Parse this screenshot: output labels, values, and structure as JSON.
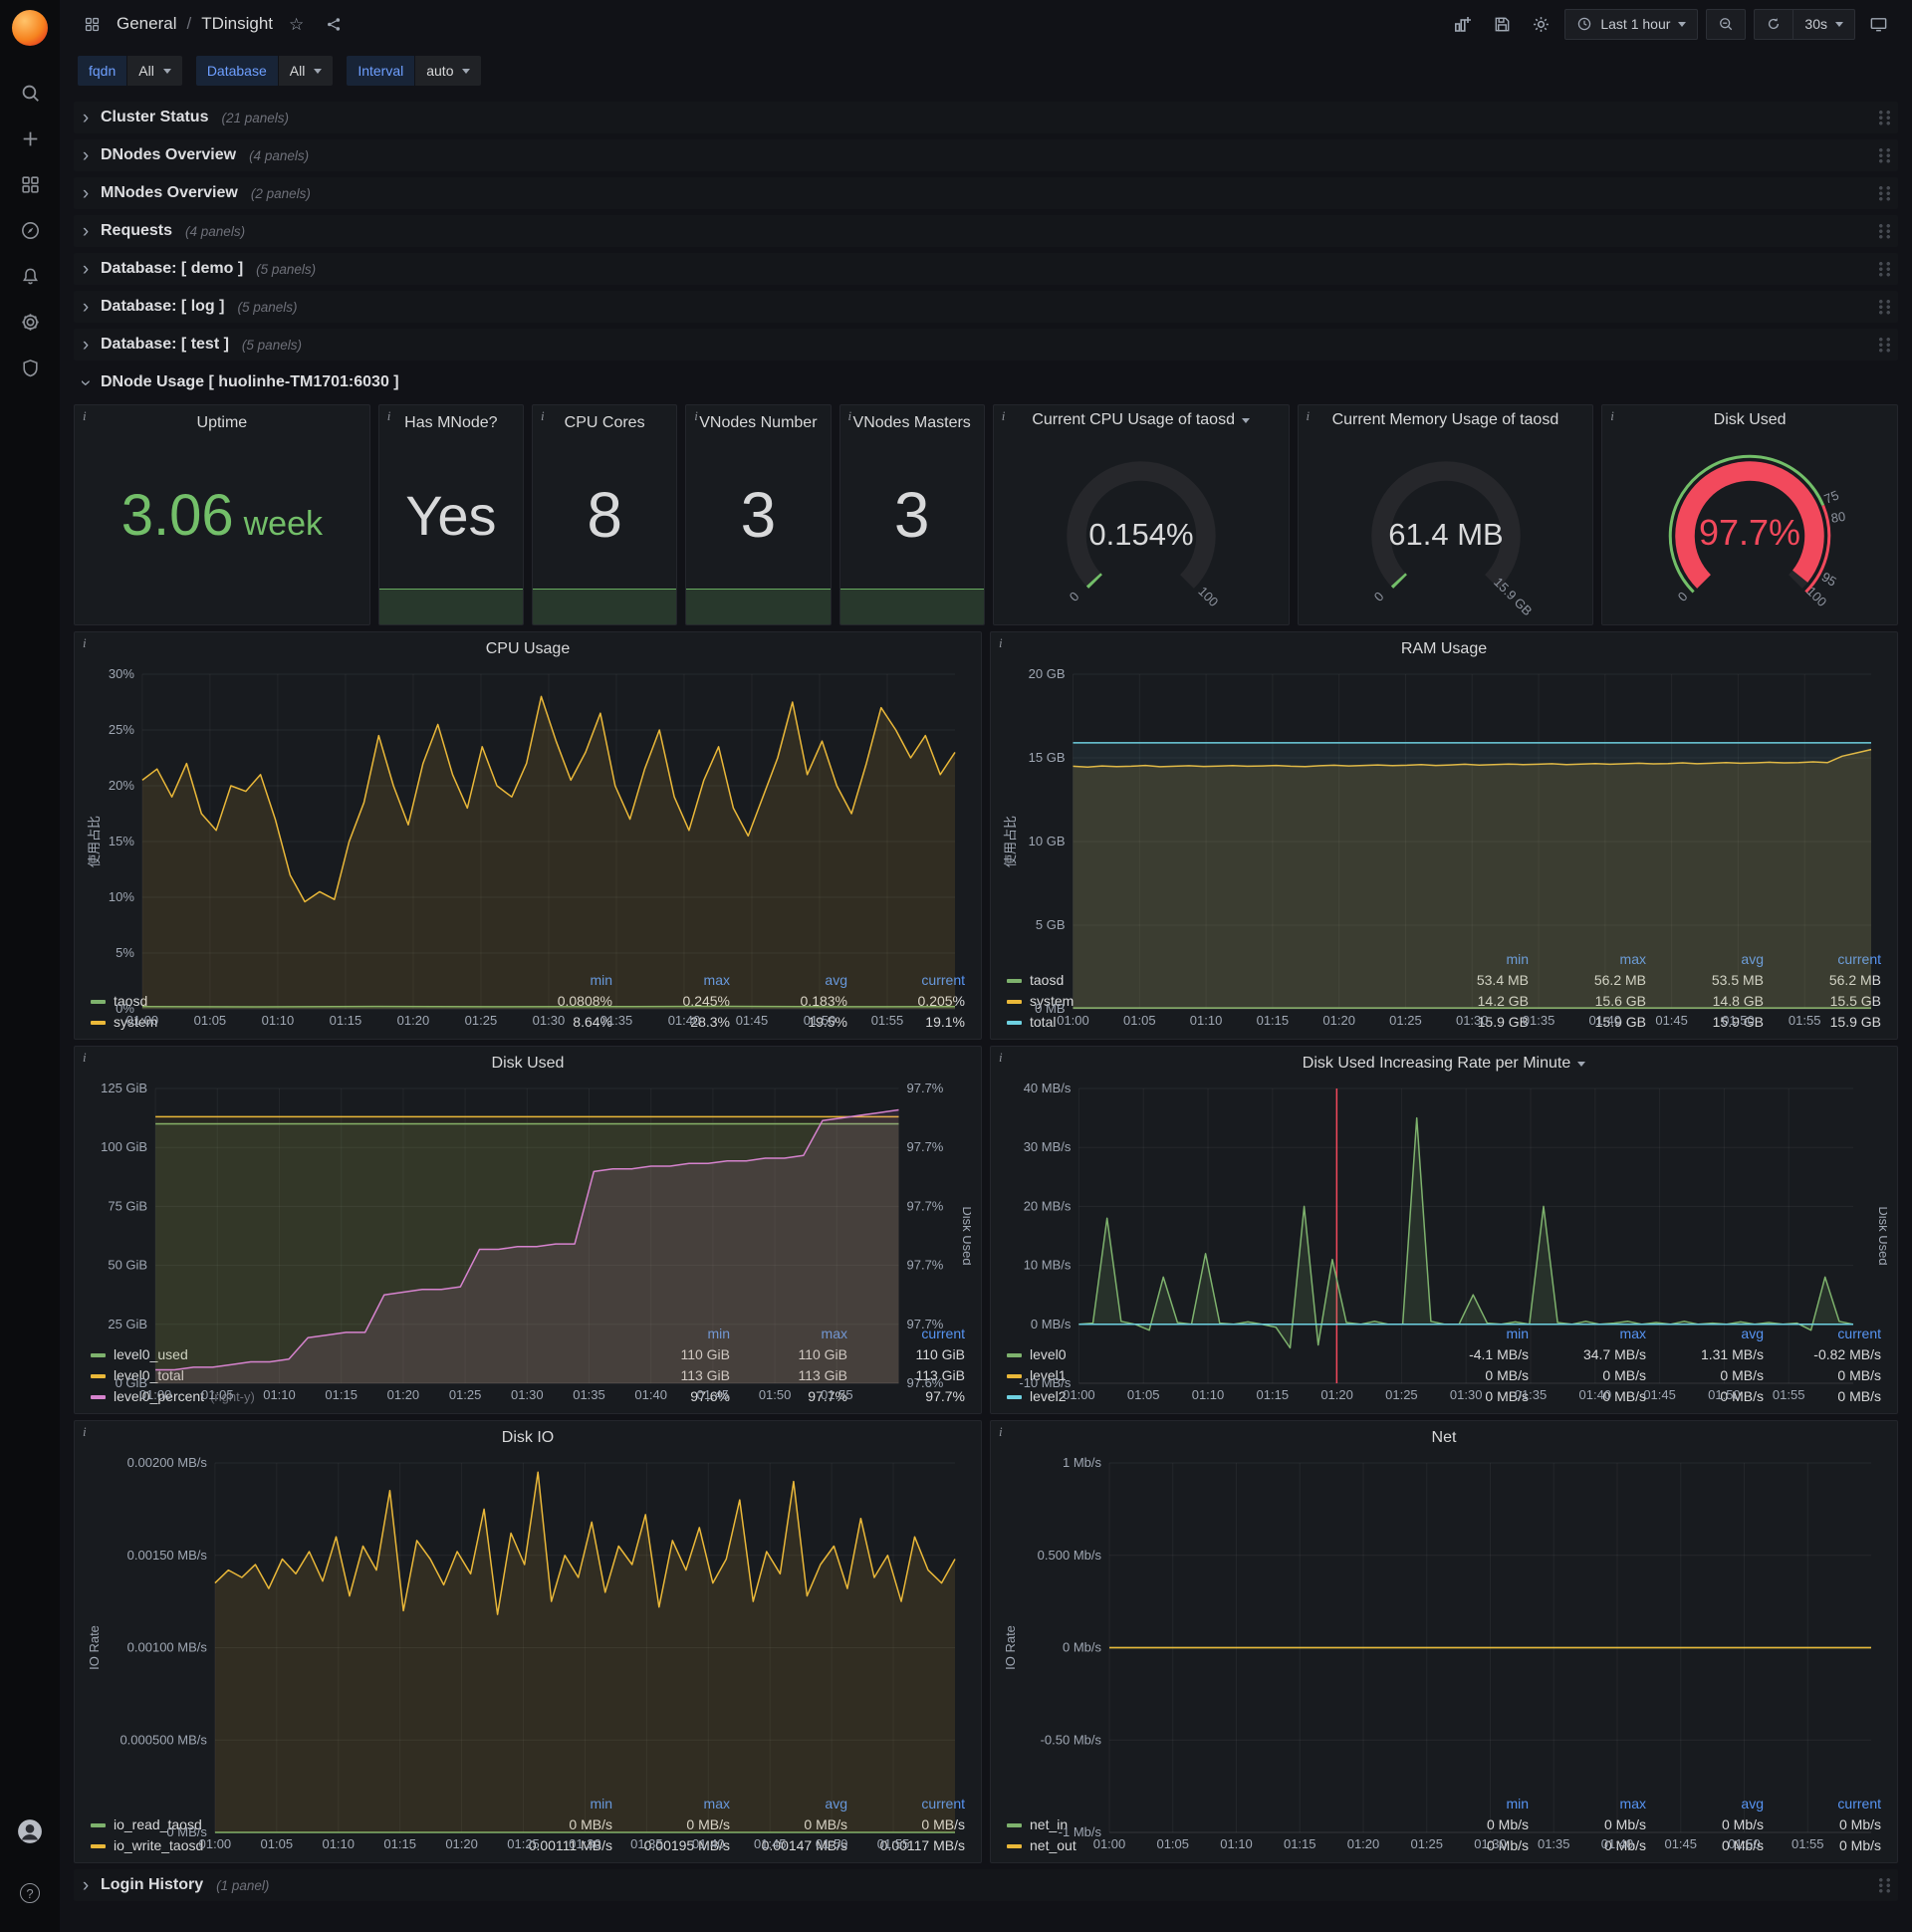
{
  "icons": {
    "info": "i",
    "star": "☆",
    "chevron": "›",
    "help": "?"
  },
  "colors": {
    "green": "#73BF69",
    "yellow": "#EAB839",
    "blue": "#6ED0E0",
    "pink": "#D683CE",
    "red": "#F2495C",
    "accent_blue": "#5794F2"
  },
  "topnav": {
    "section": "General",
    "separator": "/",
    "title": "TDinsight",
    "time_range": "Last 1 hour",
    "refresh": "30s"
  },
  "variables": [
    {
      "label": "fqdn",
      "value": "All"
    },
    {
      "label": "Database",
      "value": "All"
    },
    {
      "label": "Interval",
      "value": "auto"
    }
  ],
  "rows": [
    {
      "title": "Cluster Status",
      "count": "(21 panels)"
    },
    {
      "title": "DNodes Overview",
      "count": "(4 panels)"
    },
    {
      "title": "MNodes Overview",
      "count": "(2 panels)"
    },
    {
      "title": "Requests",
      "count": "(4 panels)"
    },
    {
      "title": "Database: [ demo ]",
      "count": "(5 panels)"
    },
    {
      "title": "Database: [ log ]",
      "count": "(5 panels)"
    },
    {
      "title": "Database: [ test ]",
      "count": "(5 panels)"
    }
  ],
  "expanded_row": {
    "title": "DNode Usage [ huolinhe-TM1701:6030 ]"
  },
  "bottom_row": {
    "title": "Login History",
    "count": "(1 panel)"
  },
  "stats": {
    "uptime": {
      "title": "Uptime",
      "value": "3.06",
      "unit": "week"
    },
    "has_mnode": {
      "title": "Has MNode?",
      "value": "Yes"
    },
    "cpu_cores": {
      "title": "CPU Cores",
      "value": "8"
    },
    "vnodes_number": {
      "title": "VNodes Number",
      "value": "3"
    },
    "vnodes_masters": {
      "title": "VNodes Masters",
      "value": "3"
    }
  },
  "gauges": [
    {
      "title": "Current CPU Usage of taosd",
      "value": "0.154%",
      "fraction": 0.00154,
      "value_color": "#d8d9da",
      "arc_color": "#73BF69",
      "value_size": 31,
      "labels": [
        {
          "text": "0",
          "frac": 0
        },
        {
          "text": "100",
          "frac": 1
        }
      ]
    },
    {
      "title": "Current Memory Usage of taosd",
      "value": "61.4 MB",
      "fraction": 0.004,
      "value_color": "#d8d9da",
      "arc_color": "#73BF69",
      "value_size": 31,
      "labels": [
        {
          "text": "0",
          "frac": 0
        },
        {
          "text": "15.9 GB",
          "frac": 1
        }
      ]
    },
    {
      "title": "Disk Used",
      "value": "97.7%",
      "fraction": 0.977,
      "value_color": "#F2495C",
      "arc_color": "#F2495C",
      "value_size": 36,
      "threshold_ring": [
        {
          "from": 0,
          "to": 0.75,
          "color": "#73BF69"
        },
        {
          "from": 0.75,
          "to": 1,
          "color": "#F2495C"
        }
      ],
      "labels": [
        {
          "text": "0",
          "frac": 0
        },
        {
          "text": "75",
          "frac": 0.75
        },
        {
          "text": "80",
          "frac": 0.8
        },
        {
          "text": "95",
          "frac": 0.95
        },
        {
          "text": "100",
          "frac": 1
        }
      ]
    }
  ],
  "chart_data": [
    {
      "id": "cpu_usage",
      "type": "line",
      "title": "CPU Usage",
      "ylabel": "使用占比",
      "y_min": 0,
      "y_max": 30,
      "left_ticks": [
        "0%",
        "5%",
        "10%",
        "15%",
        "20%",
        "25%",
        "30%"
      ],
      "x_ticks": [
        "01:00",
        "01:05",
        "01:10",
        "01:15",
        "01:20",
        "01:25",
        "01:30",
        "01:35",
        "01:40",
        "01:45",
        "01:50",
        "01:55"
      ],
      "series": [
        {
          "name": "taosd",
          "color": "#7EB26D",
          "fill": 0.12,
          "values": [
            0.2,
            0.18,
            0.21,
            0.19,
            0.2,
            0.22,
            0.19,
            0.2
          ]
        },
        {
          "name": "system",
          "color": "#EAB839",
          "fill": 0.12,
          "values": [
            20.5,
            21.5,
            19,
            22,
            17.5,
            16,
            20,
            19.5,
            21,
            17,
            12,
            9.6,
            10.5,
            9.8,
            15,
            18.5,
            24.5,
            20,
            16.5,
            22,
            25.5,
            21,
            18,
            23.5,
            20,
            19,
            22,
            28,
            24,
            20.5,
            23,
            26.5,
            20,
            17,
            21.5,
            25,
            19,
            16,
            20.5,
            23.5,
            18,
            15.5,
            19,
            22.5,
            27.5,
            21,
            24,
            20,
            17.5,
            22,
            27,
            25,
            22.5,
            24.5,
            21,
            23
          ]
        }
      ],
      "legend": {
        "columns": [
          "min",
          "max",
          "avg",
          "current"
        ],
        "rows": [
          {
            "name": "taosd",
            "color": "#7EB26D",
            "values": [
              "0.0808%",
              "0.245%",
              "0.183%",
              "0.205%"
            ]
          },
          {
            "name": "system",
            "color": "#EAB839",
            "values": [
              "8.64%",
              "28.3%",
              "19.5%",
              "19.1%"
            ]
          }
        ]
      }
    },
    {
      "id": "ram_usage",
      "type": "line",
      "title": "RAM Usage",
      "ylabel": "使用占比",
      "y_min": 0,
      "y_max": 20,
      "left_ticks": [
        "0 MB",
        "5 GB",
        "10 GB",
        "15 GB",
        "20 GB"
      ],
      "x_ticks": [
        "01:00",
        "01:05",
        "01:10",
        "01:15",
        "01:20",
        "01:25",
        "01:30",
        "01:35",
        "01:40",
        "01:45",
        "01:50",
        "01:55"
      ],
      "series": [
        {
          "name": "taosd",
          "color": "#7EB26D",
          "fill": 0.15,
          "values": [
            0.053,
            0.053
          ]
        },
        {
          "name": "system",
          "color": "#EAB839",
          "fill": 0.15,
          "values": [
            14.5,
            14.45,
            14.52,
            14.48,
            14.5,
            14.55,
            14.47,
            14.5,
            14.53,
            14.49,
            14.51,
            14.54,
            14.5,
            14.52,
            14.55,
            14.5,
            14.48,
            14.53,
            14.56,
            14.52,
            14.55,
            14.58,
            14.54,
            14.56,
            14.6,
            14.55,
            14.58,
            14.62,
            14.57,
            14.6,
            14.63,
            14.6,
            14.62,
            14.65,
            14.6,
            14.63,
            14.66,
            14.62,
            14.65,
            14.68,
            14.64,
            14.66,
            14.7,
            14.65,
            14.68,
            14.72,
            14.68,
            14.7,
            14.74,
            14.7,
            14.72,
            14.76,
            14.72,
            15.1,
            15.3,
            15.5
          ]
        },
        {
          "name": "total",
          "color": "#6ED0E0",
          "fill": 0.08,
          "values": [
            15.9,
            15.9
          ]
        }
      ],
      "legend": {
        "columns": [
          "min",
          "max",
          "avg",
          "current"
        ],
        "rows": [
          {
            "name": "taosd",
            "color": "#7EB26D",
            "values": [
              "53.4 MB",
              "56.2 MB",
              "53.5 MB",
              "56.2 MB"
            ]
          },
          {
            "name": "system",
            "color": "#EAB839",
            "values": [
              "14.2 GB",
              "15.6 GB",
              "14.8 GB",
              "15.5 GB"
            ]
          },
          {
            "name": "total",
            "color": "#6ED0E0",
            "values": [
              "15.9 GB",
              "15.9 GB",
              "15.9 GB",
              "15.9 GB"
            ]
          }
        ]
      }
    },
    {
      "id": "disk_used",
      "type": "line",
      "title": "Disk Used",
      "y_min": 0,
      "y_max": 125,
      "right_min": 97.595,
      "right_max": 97.705,
      "right_label": "Disk Used",
      "left_ticks": [
        "0 GiB",
        "25 GiB",
        "50 GiB",
        "75 GiB",
        "100 GiB",
        "125 GiB"
      ],
      "right_ticks": [
        "97.6%",
        "97.7%",
        "97.7%",
        "97.7%",
        "97.7%",
        "97.7%"
      ],
      "x_ticks": [
        "01:00",
        "01:05",
        "01:10",
        "01:15",
        "01:20",
        "01:25",
        "01:30",
        "01:35",
        "01:40",
        "01:45",
        "01:50",
        "01:55"
      ],
      "series": [
        {
          "name": "level0_used",
          "color": "#7EB26D",
          "fill": 0.12,
          "values": [
            110,
            110
          ]
        },
        {
          "name": "level0_total",
          "color": "#EAB839",
          "fill": 0.08,
          "values": [
            113,
            113
          ]
        },
        {
          "name": "level0_percent",
          "color": "#D683CE",
          "fill": 0.12,
          "axis": "right",
          "values": [
            97.6,
            97.6,
            97.601,
            97.601,
            97.602,
            97.603,
            97.603,
            97.604,
            97.612,
            97.613,
            97.614,
            97.614,
            97.628,
            97.629,
            97.63,
            97.63,
            97.631,
            97.645,
            97.645,
            97.646,
            97.646,
            97.647,
            97.647,
            97.674,
            97.675,
            97.675,
            97.676,
            97.676,
            97.677,
            97.677,
            97.678,
            97.678,
            97.679,
            97.679,
            97.68,
            97.693,
            97.694,
            97.695,
            97.696,
            97.697
          ]
        }
      ],
      "legend": {
        "columns": [
          "min",
          "max",
          "current"
        ],
        "rows": [
          {
            "name": "level0_used",
            "color": "#7EB26D",
            "values": [
              "110 GiB",
              "110 GiB",
              "110 GiB"
            ]
          },
          {
            "name": "level0_total",
            "color": "#EAB839",
            "values": [
              "113 GiB",
              "113 GiB",
              "113 GiB"
            ]
          },
          {
            "name": "level0_percent",
            "suffix": "(right-y)",
            "color": "#D683CE",
            "values": [
              "97.6%",
              "97.7%",
              "97.7%"
            ]
          }
        ]
      }
    },
    {
      "id": "disk_rate",
      "type": "line",
      "title": "Disk Used Increasing Rate per Minute",
      "has_dropdown": true,
      "y_min": -10,
      "y_max": 40,
      "right_label": "Disk Used",
      "annotation_frac": 0.333,
      "left_ticks": [
        "-10 MB/s",
        "0 MB/s",
        "10 MB/s",
        "20 MB/s",
        "30 MB/s",
        "40 MB/s"
      ],
      "x_ticks": [
        "01:00",
        "01:05",
        "01:10",
        "01:15",
        "01:20",
        "01:25",
        "01:30",
        "01:35",
        "01:40",
        "01:45",
        "01:50",
        "01:55"
      ],
      "series": [
        {
          "name": "level0",
          "color": "#7EB26D",
          "fill": 0.15,
          "values": [
            0,
            0.2,
            18,
            0.5,
            0,
            -1,
            8,
            0.3,
            0,
            12,
            0.2,
            0,
            0.4,
            0,
            -0.5,
            -4,
            20,
            -3.5,
            11,
            0.3,
            0,
            0.5,
            0,
            0,
            35,
            0.5,
            0,
            0,
            5,
            0.2,
            0,
            0.4,
            0,
            20,
            0.3,
            0,
            0.5,
            0,
            0.2,
            0.5,
            0,
            0.3,
            0,
            0.5,
            0,
            0.2,
            0,
            0.4,
            0,
            0.3,
            0,
            0.2,
            -1,
            8,
            0.5,
            0
          ]
        },
        {
          "name": "level1",
          "color": "#EAB839",
          "fill": 0,
          "values": [
            0,
            0
          ]
        },
        {
          "name": "level2",
          "color": "#6ED0E0",
          "fill": 0,
          "values": [
            0,
            0
          ]
        }
      ],
      "legend": {
        "columns": [
          "min",
          "max",
          "avg",
          "current"
        ],
        "rows": [
          {
            "name": "level0",
            "color": "#7EB26D",
            "values": [
              "-4.1 MB/s",
              "34.7 MB/s",
              "1.31 MB/s",
              "-0.82 MB/s"
            ]
          },
          {
            "name": "level1",
            "color": "#EAB839",
            "values": [
              "0 MB/s",
              "0 MB/s",
              "0 MB/s",
              "0 MB/s"
            ]
          },
          {
            "name": "level2",
            "color": "#6ED0E0",
            "values": [
              "0 MB/s",
              "0 MB/s",
              "0 MB/s",
              "0 MB/s"
            ]
          }
        ]
      }
    },
    {
      "id": "disk_io",
      "type": "line",
      "title": "Disk IO",
      "ylabel": "IO Rate",
      "y_min": 0,
      "y_max": 0.002,
      "left_ticks": [
        "0 MB/s",
        "0.000500 MB/s",
        "0.00100 MB/s",
        "0.00150 MB/s",
        "0.00200 MB/s"
      ],
      "x_ticks": [
        "01:00",
        "01:05",
        "01:10",
        "01:15",
        "01:20",
        "01:25",
        "01:30",
        "01:35",
        "01:40",
        "01:45",
        "01:50",
        "01:55"
      ],
      "series": [
        {
          "name": "io_read_taosd",
          "color": "#7EB26D",
          "fill": 0.1,
          "values": [
            0,
            0
          ]
        },
        {
          "name": "io_write_taosd",
          "color": "#EAB839",
          "fill": 0.12,
          "values": [
            0.00135,
            0.00142,
            0.00138,
            0.00145,
            0.00132,
            0.00148,
            0.0014,
            0.00152,
            0.00136,
            0.0016,
            0.00128,
            0.00155,
            0.00142,
            0.00185,
            0.0012,
            0.00158,
            0.00148,
            0.00134,
            0.00152,
            0.0014,
            0.00175,
            0.00118,
            0.00162,
            0.00145,
            0.00195,
            0.00125,
            0.0015,
            0.00138,
            0.00168,
            0.0013,
            0.00155,
            0.00145,
            0.00172,
            0.00122,
            0.00158,
            0.00142,
            0.00165,
            0.00135,
            0.00148,
            0.0018,
            0.00125,
            0.00152,
            0.0014,
            0.0019,
            0.00128,
            0.00145,
            0.00155,
            0.00132,
            0.0017,
            0.00138,
            0.0015,
            0.00125,
            0.0016,
            0.00142,
            0.00135,
            0.00148
          ]
        }
      ],
      "legend": {
        "columns": [
          "min",
          "max",
          "avg",
          "current"
        ],
        "rows": [
          {
            "name": "io_read_taosd",
            "color": "#7EB26D",
            "values": [
              "0 MB/s",
              "0 MB/s",
              "0 MB/s",
              "0 MB/s"
            ]
          },
          {
            "name": "io_write_taosd",
            "color": "#EAB839",
            "values": [
              "0.00111 MB/s",
              "0.00195 MB/s",
              "0.00147 MB/s",
              "0.00117 MB/s"
            ]
          }
        ]
      }
    },
    {
      "id": "net",
      "type": "line",
      "title": "Net",
      "ylabel": "IO Rate",
      "y_min": -1,
      "y_max": 1,
      "left_ticks": [
        "-1 Mb/s",
        "-0.50 Mb/s",
        "0 Mb/s",
        "0.500 Mb/s",
        "1 Mb/s"
      ],
      "x_ticks": [
        "01:00",
        "01:05",
        "01:10",
        "01:15",
        "01:20",
        "01:25",
        "01:30",
        "01:35",
        "01:40",
        "01:45",
        "01:50",
        "01:55"
      ],
      "series": [
        {
          "name": "net_in",
          "color": "#7EB26D",
          "fill": 0.1,
          "values": [
            0,
            0
          ]
        },
        {
          "name": "net_out",
          "color": "#EAB839",
          "fill": 0.1,
          "values": [
            0,
            0
          ]
        }
      ],
      "legend": {
        "columns": [
          "min",
          "max",
          "avg",
          "current"
        ],
        "rows": [
          {
            "name": "net_in",
            "color": "#7EB26D",
            "values": [
              "0 Mb/s",
              "0 Mb/s",
              "0 Mb/s",
              "0 Mb/s"
            ]
          },
          {
            "name": "net_out",
            "color": "#EAB839",
            "values": [
              "0 Mb/s",
              "0 Mb/s",
              "0 Mb/s",
              "0 Mb/s"
            ]
          }
        ]
      }
    }
  ]
}
